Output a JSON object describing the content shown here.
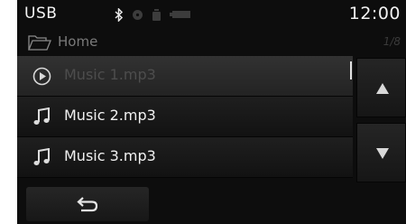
{
  "status": {
    "source": "USB",
    "time": "12:00",
    "icons": [
      "bluetooth-icon",
      "disc-icon",
      "phone-signal-icon",
      "battery-icon"
    ]
  },
  "path": {
    "folder_icon": "folder-open-icon",
    "label": "Home",
    "counter": "1/8"
  },
  "file_list": {
    "items": [
      {
        "label": "Music 1.mp3",
        "icon": "play-circle-icon",
        "selected": true
      },
      {
        "label": "Music 2.mp3",
        "icon": "music-note-icon",
        "selected": false
      },
      {
        "label": "Music 3.mp3",
        "icon": "music-note-icon",
        "selected": false
      }
    ]
  },
  "controls": {
    "scroll_up_icon": "triangle-up-icon",
    "scroll_down_icon": "triangle-down-icon",
    "back_icon": "back-arrow-icon"
  },
  "colors": {
    "background": "#0d0d0d",
    "row": "#1a1a1a",
    "row_selected": "#2a2a2a",
    "text": "#f0f0f0",
    "text_dim": "#7a7a7a"
  }
}
